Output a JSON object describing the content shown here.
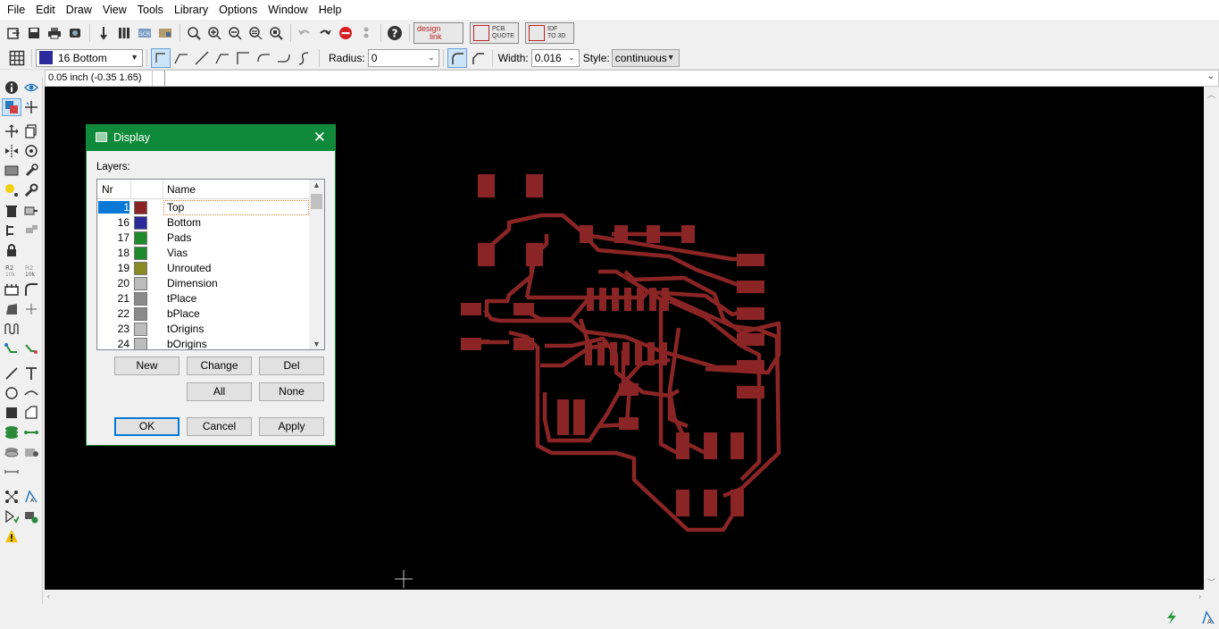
{
  "menu": [
    "File",
    "Edit",
    "Draw",
    "View",
    "Tools",
    "Library",
    "Options",
    "Window",
    "Help"
  ],
  "toolbar": {
    "logos": [
      {
        "line1": "design",
        "line2": "link"
      },
      {
        "line1": "PCB",
        "line2": "QUOTE"
      },
      {
        "line1": "IDF",
        "line2": "TO 3D"
      }
    ]
  },
  "toolbar2": {
    "layer_value": "16 Bottom",
    "layer_color": "#2a2a9a",
    "radius_label": "Radius:",
    "radius_value": "0",
    "width_label": "Width:",
    "width_value": "0.016",
    "style_label": "Style:",
    "style_value": "continuous"
  },
  "command": {
    "coordinates": "0.05 inch (-0.35 1.65)"
  },
  "dialog": {
    "title": "Display",
    "layers_label": "Layers:",
    "columns": {
      "nr": "Nr",
      "name": "Name"
    },
    "layers": [
      {
        "nr": "1",
        "name": "Top",
        "color": "#8b2525",
        "selected": true
      },
      {
        "nr": "16",
        "name": "Bottom",
        "color": "#2a2a9a",
        "selected": false
      },
      {
        "nr": "17",
        "name": "Pads",
        "color": "#1e8a2a",
        "selected": false
      },
      {
        "nr": "18",
        "name": "Vias",
        "color": "#1e8a2a",
        "selected": false
      },
      {
        "nr": "19",
        "name": "Unrouted",
        "color": "#8a8a25",
        "selected": false
      },
      {
        "nr": "20",
        "name": "Dimension",
        "color": "#bcbcbc",
        "selected": false
      },
      {
        "nr": "21",
        "name": "tPlace",
        "color": "#8a8a8a",
        "selected": false
      },
      {
        "nr": "22",
        "name": "bPlace",
        "color": "#8a8a8a",
        "selected": false
      },
      {
        "nr": "23",
        "name": "tOrigins",
        "color": "#bcbcbc",
        "selected": false
      },
      {
        "nr": "24",
        "name": "bOrigins",
        "color": "#bcbcbc",
        "selected": false
      }
    ],
    "buttons": {
      "new": "New",
      "change": "Change",
      "del": "Del",
      "all": "All",
      "none": "None",
      "ok": "OK",
      "cancel": "Cancel",
      "apply": "Apply"
    }
  },
  "colors": {
    "canvas": "#000000",
    "copper": "#8b2525",
    "dialog_title": "#0f8a3a",
    "selection": "#0a78d7"
  }
}
